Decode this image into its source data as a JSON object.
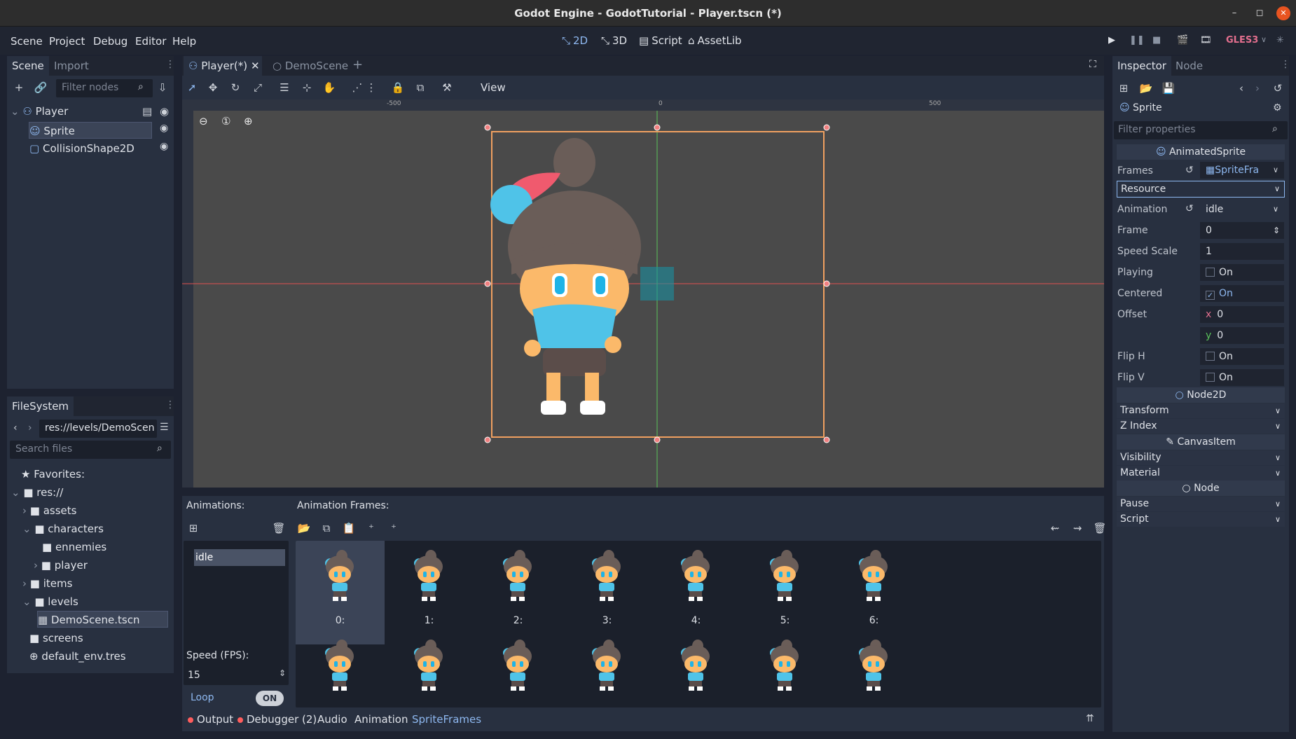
{
  "window": {
    "title": "Godot Engine - GodotTutorial - Player.tscn (*)",
    "min": "–",
    "max": "◻",
    "close": "✕"
  },
  "menu": {
    "items": [
      "Scene",
      "Project",
      "Debug",
      "Editor",
      "Help"
    ],
    "workspaces": [
      "2D",
      "3D",
      "Script",
      "AssetLib"
    ],
    "renderer": "GLES3"
  },
  "scene_dock": {
    "tabs": [
      "Scene",
      "Import"
    ],
    "filter_placeholder": "Filter nodes",
    "nodes": [
      {
        "name": "Player"
      },
      {
        "name": "Sprite"
      },
      {
        "name": "CollisionShape2D"
      }
    ]
  },
  "filesystem": {
    "tab": "FileSystem",
    "path": "res://levels/DemoScen",
    "search_placeholder": "Search files",
    "items": [
      "Favorites:",
      "res://",
      "assets",
      "characters",
      "ennemies",
      "player",
      "items",
      "levels",
      "DemoScene.tscn",
      "screens",
      "default_env.tres"
    ]
  },
  "scene_tabs": [
    "Player(*)",
    "DemoScene"
  ],
  "toolbar": {
    "view": "View"
  },
  "ruler": {
    "labels": [
      "-500",
      "0",
      "500"
    ]
  },
  "anim_panel": {
    "animations_label": "Animations:",
    "frames_label": "Animation Frames:",
    "animation_list": [
      "idle"
    ],
    "speed_label": "Speed (FPS):",
    "speed_value": "15",
    "loop_label": "Loop",
    "loop_toggle": "ON",
    "frames": [
      "0:",
      "1:",
      "2:",
      "3:",
      "4:",
      "5:",
      "6:"
    ]
  },
  "bottom_tabs": [
    "Output",
    "Debugger (2)",
    "Audio",
    "Animation",
    "SpriteFrames"
  ],
  "inspector": {
    "tabs": [
      "Inspector",
      "Node"
    ],
    "node_name": "Sprite",
    "filter_placeholder": "Filter properties",
    "class_header": "AnimatedSprite",
    "frames_label": "Frames",
    "frames_value": "SpriteFra",
    "resource": "Resource",
    "animation_label": "Animation",
    "animation_value": "idle",
    "frame_label": "Frame",
    "frame_value": "0",
    "speed_scale_label": "Speed Scale",
    "speed_scale_value": "1",
    "playing_label": "Playing",
    "playing_value": "On",
    "centered_label": "Centered",
    "centered_value": "On",
    "offset_label": "Offset",
    "offset_x": "0",
    "offset_y": "0",
    "fliph_label": "Flip H",
    "fliph_value": "On",
    "flipv_label": "Flip V",
    "flipv_value": "On",
    "node2d": "Node2D",
    "transform": "Transform",
    "zindex": "Z Index",
    "canvasitem": "CanvasItem",
    "visibility": "Visibility",
    "material": "Material",
    "node": "Node",
    "pause": "Pause",
    "script": "Script"
  }
}
